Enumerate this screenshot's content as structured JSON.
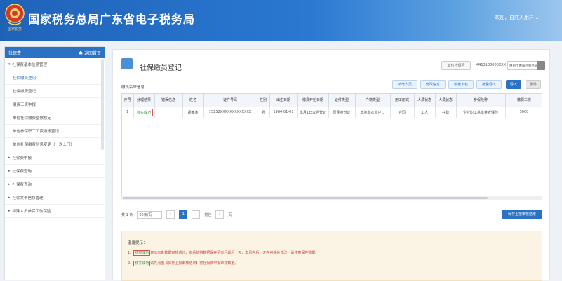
{
  "header": {
    "emblem_text": "国家税务",
    "title": "国家税务总局广东省电子税务局",
    "welcome": "欢迎，自然人用户..."
  },
  "sidebar": {
    "title": "社保费",
    "back_label": "返回首页",
    "items": [
      {
        "label": "社保费基本信息管理",
        "level": "group",
        "caret": "▾"
      },
      {
        "label": "社保缴员登记",
        "level": "child",
        "active": true
      },
      {
        "label": "社保缴费登记",
        "level": "child"
      },
      {
        "label": "缴费工资申报",
        "level": "child"
      },
      {
        "label": "单位社保缴费基数核定",
        "level": "child"
      },
      {
        "label": "单位参保职工工资填报登记",
        "level": "child"
      },
      {
        "label": "单位社保缴费信息变更（一次上门）",
        "level": "child"
      },
      {
        "label": "社保费申报",
        "level": "group",
        "caret": "▸"
      },
      {
        "label": "社保费查询",
        "level": "group",
        "caret": "▸"
      },
      {
        "label": "社保费查询",
        "level": "group",
        "caret": "▸"
      },
      {
        "label": "社保文书信息管理",
        "level": "group",
        "caret": "▸"
      },
      {
        "label": "特殊人员参保工伤保险",
        "level": "group",
        "caret": "▸"
      }
    ]
  },
  "main": {
    "title": "社保缴员登记",
    "id_label": "单位社保号",
    "id_value": "4413130000XXX",
    "id_select": "惠州市惠阳区税务局第一...",
    "toolbar": {
      "add": "新增人员",
      "modify": "修改信息",
      "template": "模板下载",
      "batch": "批量导入",
      "import": "导入",
      "delete": "删除"
    },
    "list_label": "缴员名单信息",
    "columns": [
      "序号",
      "处理结果",
      "错误信息",
      "姓名",
      "证件号码",
      "性别",
      "出生日期",
      "缴费开始日期",
      "证件类型",
      "户籍类型",
      "用工形式",
      "人员状态",
      "人员状态",
      "参保险种",
      "缴费工资"
    ],
    "rows": [
      [
        "1",
        "核实成功",
        "",
        "胡某某",
        "15252XXXXXXXXXXXXX",
        "男",
        "1984-01-01",
        "本月1日以后登记",
        "居民身份证",
        "本地非农业户口",
        "合同",
        "工人",
        "在职",
        "企业职工基本养老保险",
        "5000"
      ]
    ],
    "pager": {
      "total": "共 1 条",
      "per_page": "20条/页",
      "prev": "‹",
      "current": "1",
      "next": "›",
      "goto_label": "前往",
      "goto_value": "1",
      "goto_unit": "页"
    },
    "upload_button": "保存上报审核结果",
    "tips": {
      "title": "温馨提示：",
      "items": [
        {
          "num": "1、",
          "highlight": "核实成功",
          "text": "表示本条数据审核通过，本系统将数据保存至本月最后一天，本月内后一天内可继续修改，请注意保存数据。"
        },
        {
          "num": "2、",
          "highlight": "核实成功",
          "text": "请先点击【保存上报审核结果】将社保费申报审核数据。"
        }
      ]
    }
  }
}
